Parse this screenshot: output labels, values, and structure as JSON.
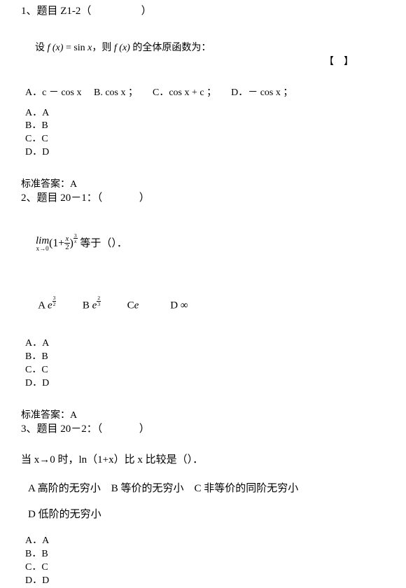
{
  "document": {
    "items": [
      {
        "heading": "1、题目 Z1-2（                   ）",
        "stem_prefix": "设 ",
        "stem_f1": "f (x)",
        "stem_mid1": " = sin ",
        "stem_x": "x",
        "stem_mid2": "，则 ",
        "stem_f2": "f (x)",
        "stem_suffix": " 的全体原函数为：",
        "bracket": "【    】",
        "inline_options": "A．c － cos x     B. cos x ；      C．cos x + c ；      D．－ cos x ；",
        "choices": [
          "A．A",
          "B．B",
          "C．C",
          "D．D"
        ],
        "answer": "标准答案：A"
      },
      {
        "heading": "2、题目 20－1：（              ）",
        "limit_label": "lim",
        "limit_sub": "x→0",
        "limit_open": "(1+",
        "limit_frac_num": "x",
        "limit_frac_den": "2",
        "limit_close": ")",
        "limit_exp_num": "3",
        "limit_exp_den": "x",
        "limit_tail": " 等于（）．",
        "opt_a_label": "A",
        "opt_a_base": "e",
        "opt_a_num": "3",
        "opt_a_den": "2",
        "opt_b_label": "B",
        "opt_b_base": "e",
        "opt_b_num": "2",
        "opt_b_den": "3",
        "opt_c_label": "C",
        "opt_c_val": "e",
        "opt_d_label": "D",
        "opt_d_val": "∞",
        "choices": [
          "A．A",
          "B．B",
          "C．C",
          "D．D"
        ],
        "answer": "标准答案：A"
      },
      {
        "heading": "3、题目 20－2：（              ）",
        "stem": "当 x→0 时，ln（1+x）比 x 比较是（）．",
        "options_line1": "A 高阶的无穷小    B 等价的无穷小    C 非等价的同阶无穷小",
        "options_line2": "D 低阶的无穷小",
        "choices": [
          "A．A",
          "B．B",
          "C．C",
          "D．D"
        ]
      }
    ]
  }
}
